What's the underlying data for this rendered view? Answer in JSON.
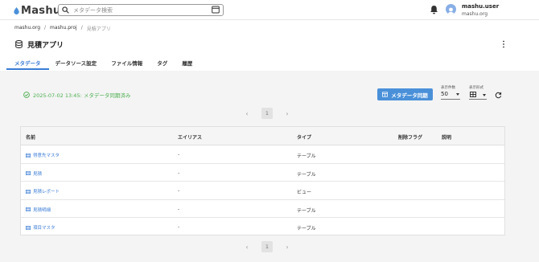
{
  "topbar": {
    "logo_text": "Mashu",
    "search_placeholder": "メタデータ検索",
    "user_name": "mashu.user",
    "user_org": "mashu.org",
    "icons": [
      "drop-icon",
      "search-icon",
      "filter-icon",
      "bell-icon",
      "avatar"
    ]
  },
  "breadcrumb": {
    "items": [
      "mashu.org",
      "mashu.proj",
      "見積アプリ"
    ],
    "sep": "/"
  },
  "header": {
    "title": "見積アプリ"
  },
  "tabs": [
    {
      "label": "メタデータ",
      "active": true
    },
    {
      "label": "データソース設定",
      "active": false
    },
    {
      "label": "ファイル情報",
      "active": false
    },
    {
      "label": "タグ",
      "active": false
    },
    {
      "label": "履歴",
      "active": false
    }
  ],
  "toolbar": {
    "sync_status": "2025-07-02 13:45: メタデータ同期済み",
    "sync_button": "メタデータ同期",
    "count_label": "表示件数",
    "count_value": "50",
    "view_label": "表示形式"
  },
  "pager": {
    "current_page": "1",
    "prev": "‹",
    "next": "›"
  },
  "table": {
    "columns": [
      "名前",
      "エイリアス",
      "タイプ",
      "削除フラグ",
      "説明"
    ],
    "rows": [
      {
        "name": "得意先マスタ",
        "alias": "-",
        "type": "テーブル",
        "deleted": "",
        "description": ""
      },
      {
        "name": "見積",
        "alias": "-",
        "type": "テーブル",
        "deleted": "",
        "description": ""
      },
      {
        "name": "見積レポート",
        "alias": "-",
        "type": "ビュー",
        "deleted": "",
        "description": ""
      },
      {
        "name": "見積明細",
        "alias": "-",
        "type": "テーブル",
        "deleted": "",
        "description": ""
      },
      {
        "name": "項目マスタ",
        "alias": "-",
        "type": "テーブル",
        "deleted": "",
        "description": ""
      }
    ]
  },
  "colors": {
    "accent": "#3a7bd5",
    "button": "#4a90d9",
    "success": "#4caf50",
    "content_bg": "#f4f4f4"
  }
}
